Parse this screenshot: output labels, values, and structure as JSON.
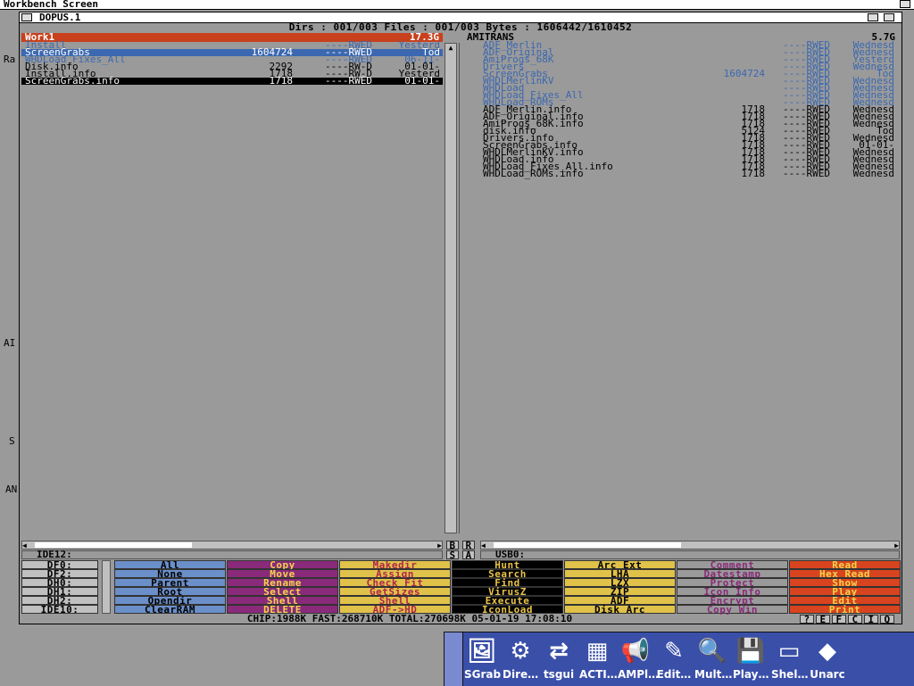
{
  "screen": {
    "title": "Workbench Screen"
  },
  "window": {
    "title": "DOPUS.1",
    "stats": "Dirs : 001/003  Files : 001/003  Bytes : 1606442/1610452"
  },
  "left": {
    "name": "Work1",
    "free": "17.3G",
    "path": "IDE12:",
    "rows": [
      {
        "name": "Install",
        "size": "",
        "prot": "----RWED",
        "date": "Yesterd",
        "kind": "dir"
      },
      {
        "name": "ScreenGrabs",
        "size": "1604724",
        "prot": "----RWED",
        "date": "Tod",
        "kind": "dirsel"
      },
      {
        "name": "WHDLoad_Fixes_All",
        "size": "",
        "prot": "----RWED",
        "date": "06-11-",
        "kind": "dir"
      },
      {
        "name": "Disk.info",
        "size": "2292",
        "prot": "----RW-D",
        "date": "01-01-",
        "kind": "file"
      },
      {
        "name": "Install.info",
        "size": "1718",
        "prot": "----RW-D",
        "date": "Yesterd",
        "kind": "file"
      },
      {
        "name": "ScreenGrabs.info",
        "size": "1718",
        "prot": "----RWED",
        "date": "01-01-",
        "kind": "filesel"
      }
    ]
  },
  "right": {
    "name": "AMITRANS",
    "free": "5.7G",
    "path": "USB0:",
    "rows": [
      {
        "name": "ADF_Merlin",
        "size": "",
        "prot": "----RWED",
        "date": "Wednesd",
        "kind": "dir"
      },
      {
        "name": "ADF_Original",
        "size": "",
        "prot": "----RWED",
        "date": "Wednesd",
        "kind": "dir"
      },
      {
        "name": "AmiProgs_68K",
        "size": "",
        "prot": "----RWED",
        "date": "Yesterd",
        "kind": "dir"
      },
      {
        "name": "Drivers",
        "size": "",
        "prot": "----RWED",
        "date": "Wednesd",
        "kind": "dir"
      },
      {
        "name": "ScreenGrabs",
        "size": "1604724",
        "prot": "----RWED",
        "date": "Tod",
        "kind": "dir"
      },
      {
        "name": "WHDLMerlinKV",
        "size": "",
        "prot": "----RWED",
        "date": "Wednesd",
        "kind": "dir"
      },
      {
        "name": "WHDLoad",
        "size": "",
        "prot": "----RWED",
        "date": "Wednesd",
        "kind": "dir"
      },
      {
        "name": "WHDLoad_Fixes_All",
        "size": "",
        "prot": "----RWED",
        "date": "Wednesd",
        "kind": "dir"
      },
      {
        "name": "WHDLoad_ROMs",
        "size": "",
        "prot": "----RWED",
        "date": "Wednesd",
        "kind": "dir"
      },
      {
        "name": "ADF_Merlin.info",
        "size": "1718",
        "prot": "----RWED",
        "date": "Wednesd",
        "kind": "file"
      },
      {
        "name": "ADF_Original.info",
        "size": "1718",
        "prot": "----RWED",
        "date": "Wednesd",
        "kind": "file"
      },
      {
        "name": "AmiProgs_68K.info",
        "size": "1718",
        "prot": "----RWED",
        "date": "Wednesd",
        "kind": "file"
      },
      {
        "name": "disk.info",
        "size": "5124",
        "prot": "----RWED",
        "date": "Tod",
        "kind": "file"
      },
      {
        "name": "Drivers.info",
        "size": "1718",
        "prot": "----RWED",
        "date": "Wednesd",
        "kind": "file"
      },
      {
        "name": "ScreenGrabs.info",
        "size": "1718",
        "prot": "----RWED",
        "date": "01-01-",
        "kind": "file"
      },
      {
        "name": "WHDLMerlinKV.info",
        "size": "1718",
        "prot": "----RWED",
        "date": "Wednesd",
        "kind": "file"
      },
      {
        "name": "WHDLoad.info",
        "size": "1718",
        "prot": "----RWED",
        "date": "Wednesd",
        "kind": "file"
      },
      {
        "name": "WHDLoad_Fixes_All.info",
        "size": "1718",
        "prot": "----RWED",
        "date": "Wednesd",
        "kind": "file"
      },
      {
        "name": "WHDLoad_ROMs.info",
        "size": "1718",
        "prot": "----RWED",
        "date": "Wednesd",
        "kind": "file"
      }
    ]
  },
  "middle": {
    "b": "B",
    "r": "R",
    "s": "S",
    "a": "A"
  },
  "devices": [
    "DF0:",
    "DF2:",
    "DH0:",
    "DH1:",
    "DH2:",
    "IDE10:"
  ],
  "buttons": [
    {
      "group": "g1",
      "labels": [
        "All",
        "None",
        "Parent",
        "Root",
        "Opendir",
        "ClearRAM"
      ]
    },
    {
      "group": "g2",
      "labels": [
        "Copy",
        "Move",
        "Rename",
        "Select",
        "Shell",
        "DELETE"
      ]
    },
    {
      "group": "g3",
      "labels": [
        "Makedir",
        "Assign",
        "Check Fit",
        "GetSizes",
        "Shell",
        "ADF->HD"
      ]
    },
    {
      "group": "g4",
      "labels": [
        "Hunt",
        "Search",
        "Find",
        "VirusZ",
        "Execute",
        "IconLoad"
      ]
    },
    {
      "group": "g5",
      "labels": [
        "Arc Ext",
        "LHA",
        "LZX",
        "ZIP",
        "ADF",
        "Disk Arc"
      ]
    },
    {
      "group": "g6",
      "labels": [
        "Comment",
        "Datestamp",
        "Protect",
        "Icon Info",
        "Encrypt",
        "Copy Win"
      ]
    },
    {
      "group": "g7",
      "labels": [
        "Read",
        "Hex Read",
        "Show",
        "Play",
        "Edit",
        "Print"
      ]
    }
  ],
  "status": "CHIP:1988K  FAST:268710K  TOTAL:270698K  05-01-19  17:08:10",
  "statusbtns": [
    "?",
    "E",
    "F",
    "C",
    "I",
    "Q"
  ],
  "dock": [
    "SGrab",
    "Dire…",
    "tsgui",
    "ACTI…",
    "AMPl…",
    "Edit…",
    "Mult…",
    "Play…",
    "Shel…",
    "Unarc"
  ],
  "colors": {
    "title_red": "#c8401c",
    "dir_blue": "#3b68b0",
    "panel_grey": "#9a9a9a",
    "dock_blue": "#3a4fa8"
  },
  "icons": [
    "workbench-depth-icon",
    "close-icon",
    "zoom-icon",
    "depth-icon",
    "scroll-left-icon",
    "scroll-right-icon",
    "scroll-up-icon",
    "scroll-down-icon"
  ]
}
